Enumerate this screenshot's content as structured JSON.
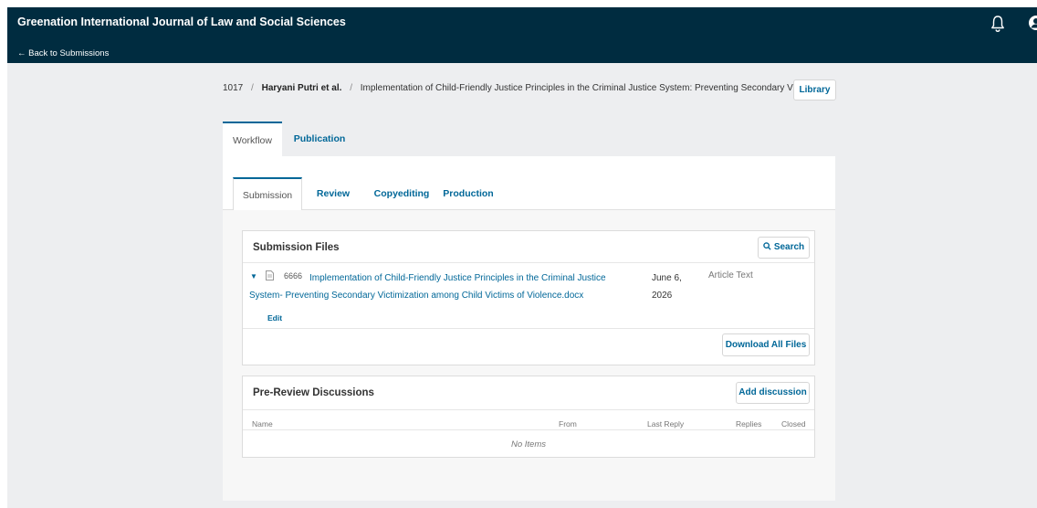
{
  "header": {
    "site_title": "Greenation International Journal of Law and Social Sciences",
    "back_label": "← Back to Submissions",
    "icons": [
      "bell-icon",
      "user-icon"
    ]
  },
  "breadcrumb": {
    "id": "1017",
    "separator": "/",
    "author": "Haryani Putri et al.",
    "title": "Implementation of Child-Friendly Justice Principles in the Criminal Justice System: Preventing Secondary V"
  },
  "library_label": "Library",
  "main_tabs": [
    {
      "label": "Workflow",
      "active": true
    },
    {
      "label": "Publication",
      "active": false
    }
  ],
  "sub_tabs": [
    {
      "label": "Submission",
      "active": true
    },
    {
      "label": "Review",
      "active": false
    },
    {
      "label": "Copyediting",
      "active": false
    },
    {
      "label": "Production",
      "active": false
    }
  ],
  "submission_files": {
    "title": "Submission Files",
    "search_label": "Search",
    "file": {
      "id": "6666",
      "name": "Implementation of Child-Friendly Justice Principles in the Criminal Justice System- Preventing Secondary Victimization among Child Victims of Violence.docx",
      "date": "June 6, 2026",
      "type": "Article Text",
      "edit_label": "Edit"
    },
    "download_label": "Download All Files"
  },
  "discussions": {
    "title": "Pre-Review Discussions",
    "add_label": "Add discussion",
    "columns": [
      "Name",
      "From",
      "Last Reply",
      "Replies",
      "Closed"
    ],
    "empty_label": "No Items"
  },
  "colors": {
    "header_bg": "#002c40",
    "link": "#006798",
    "page_bg": "#edeef0"
  }
}
